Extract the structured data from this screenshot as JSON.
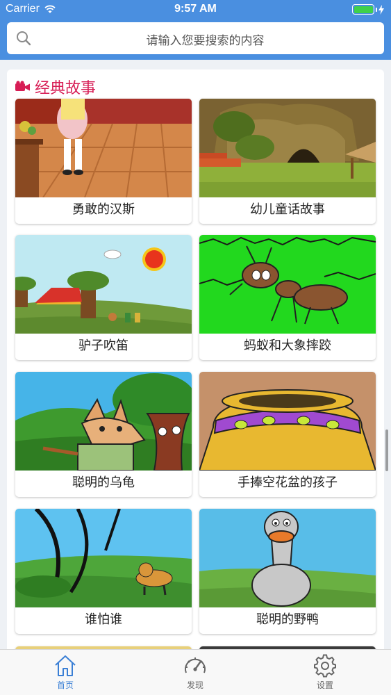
{
  "status_bar": {
    "carrier": "Carrier",
    "time": "9:57 AM"
  },
  "search": {
    "placeholder": "请输入您要搜索的内容"
  },
  "section": {
    "title": "经典故事"
  },
  "stories": [
    {
      "title": "勇敢的汉斯"
    },
    {
      "title": "幼儿童话故事"
    },
    {
      "title": "驴子吹笛"
    },
    {
      "title": "蚂蚁和大象摔跤"
    },
    {
      "title": "聪明的乌龟"
    },
    {
      "title": "手捧空花盆的孩子"
    },
    {
      "title": "谁怕谁"
    },
    {
      "title": "聪明的野鸭"
    }
  ],
  "tabs": [
    {
      "label": "首页",
      "icon": "home-icon",
      "active": true
    },
    {
      "label": "发现",
      "icon": "speedometer-icon",
      "active": false
    },
    {
      "label": "设置",
      "icon": "gear-icon",
      "active": false
    }
  ],
  "colors": {
    "accent": "#4a8fe0",
    "section_title": "#d71d55",
    "tab_active": "#3a7fd5",
    "tab_inactive": "#666666"
  }
}
